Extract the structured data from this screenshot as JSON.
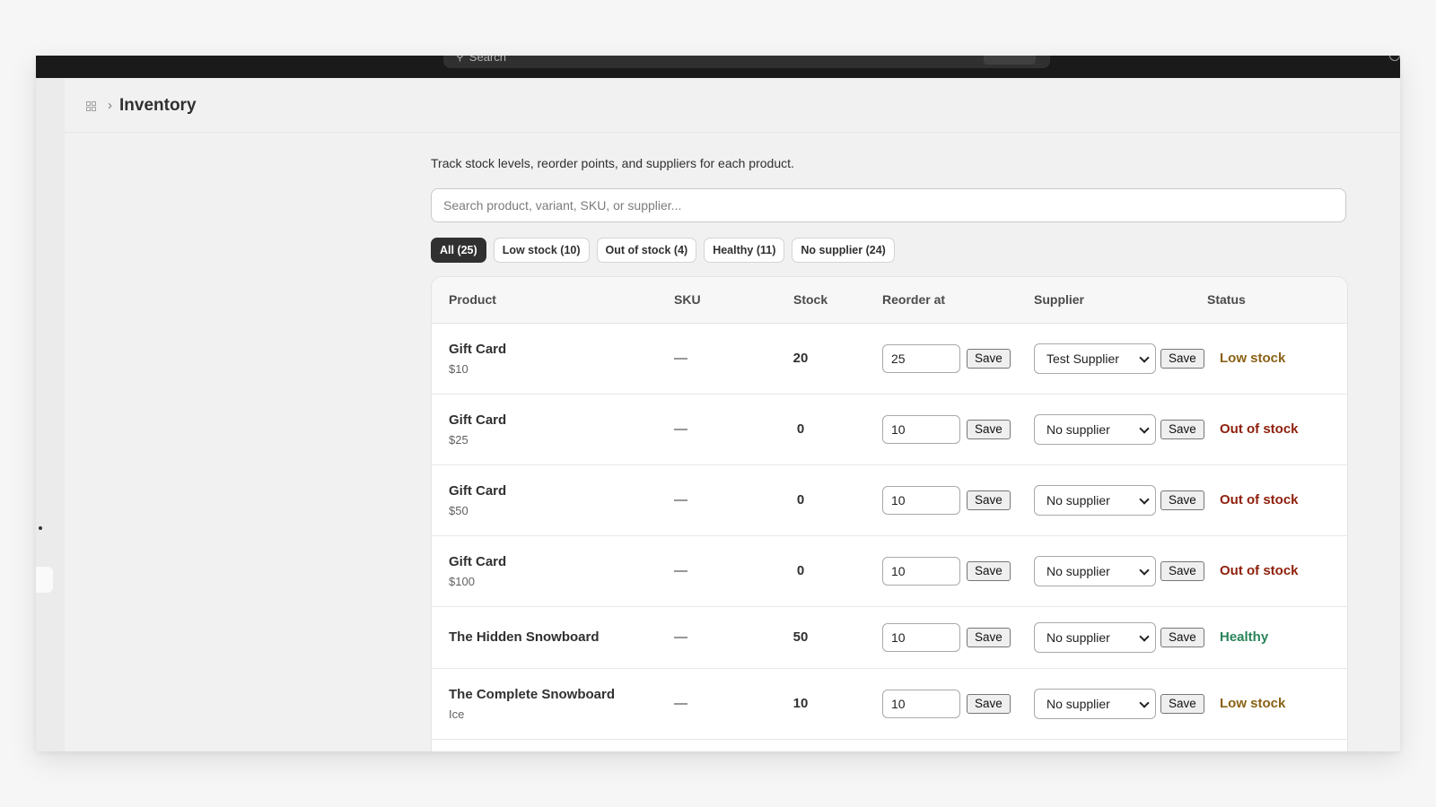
{
  "topbar": {
    "search_placeholder": "Search"
  },
  "header": {
    "title": "Inventory"
  },
  "description": "Track stock levels, reorder points, and suppliers for each product.",
  "search": {
    "placeholder": "Search product, variant, SKU, or supplier..."
  },
  "filters": [
    {
      "label": "All (25)",
      "active": true
    },
    {
      "label": "Low stock (10)",
      "active": false
    },
    {
      "label": "Out of stock (4)",
      "active": false
    },
    {
      "label": "Healthy (11)",
      "active": false
    },
    {
      "label": "No supplier (24)",
      "active": false
    }
  ],
  "table": {
    "columns": {
      "product": "Product",
      "sku": "SKU",
      "stock": "Stock",
      "reorder": "Reorder at",
      "supplier": "Supplier",
      "status": "Status"
    },
    "save_label": "Save",
    "rows": [
      {
        "name": "Gift Card",
        "variant": "$10",
        "sku": "—",
        "stock": "20",
        "reorder": "25",
        "supplier": "Test Supplier",
        "status": "Low stock",
        "status_color": "#8a6116"
      },
      {
        "name": "Gift Card",
        "variant": "$25",
        "sku": "—",
        "stock": "0",
        "reorder": "10",
        "supplier": "No supplier",
        "status": "Out of stock",
        "status_color": "#8e1f0b"
      },
      {
        "name": "Gift Card",
        "variant": "$50",
        "sku": "—",
        "stock": "0",
        "reorder": "10",
        "supplier": "No supplier",
        "status": "Out of stock",
        "status_color": "#8e1f0b"
      },
      {
        "name": "Gift Card",
        "variant": "$100",
        "sku": "—",
        "stock": "0",
        "reorder": "10",
        "supplier": "No supplier",
        "status": "Out of stock",
        "status_color": "#8e1f0b"
      },
      {
        "name": "The Hidden Snowboard",
        "variant": "",
        "sku": "—",
        "stock": "50",
        "reorder": "10",
        "supplier": "No supplier",
        "status": "Healthy",
        "status_color": "#29845a"
      },
      {
        "name": "The Complete Snowboard",
        "variant": "Ice",
        "sku": "—",
        "stock": "10",
        "reorder": "10",
        "supplier": "No supplier",
        "status": "Low stock",
        "status_color": "#8a6116"
      }
    ]
  }
}
